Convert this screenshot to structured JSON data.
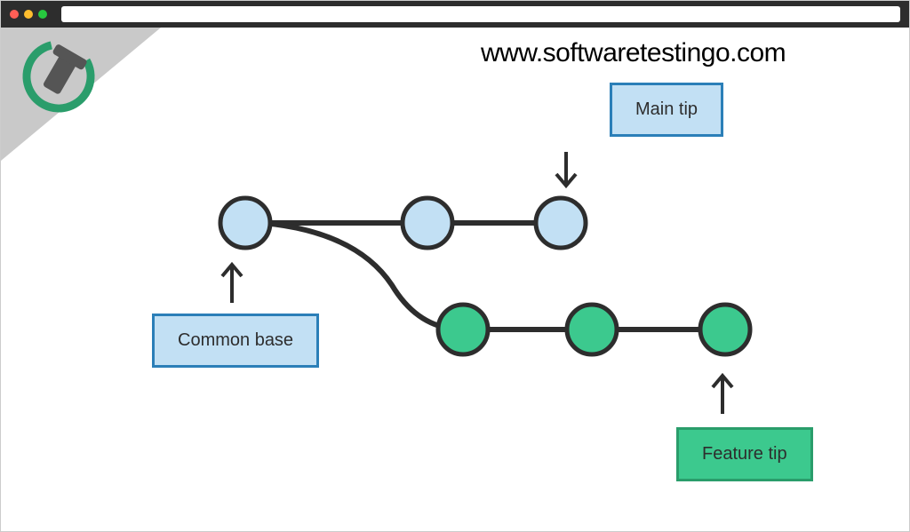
{
  "site_url": "www.softwaretestingo.com",
  "labels": {
    "main_tip": "Main tip",
    "common_base": "Common base",
    "feature_tip": "Feature tip"
  },
  "diagram_data": {
    "type": "git-branch",
    "main_branch": {
      "nodes": 3,
      "color": "blue",
      "tip_label": "Main tip",
      "base_label": "Common base"
    },
    "feature_branch": {
      "nodes": 3,
      "color": "green",
      "tip_label": "Feature tip",
      "branches_from_main_node_index": 0
    }
  },
  "colors": {
    "node_blue_fill": "#c2e0f4",
    "node_blue_stroke": "#2b7fb8",
    "node_green_fill": "#3cc98e",
    "node_green_stroke": "#2a9d6b",
    "edge": "#2d2d2d",
    "arrow": "#2d2d2d"
  }
}
